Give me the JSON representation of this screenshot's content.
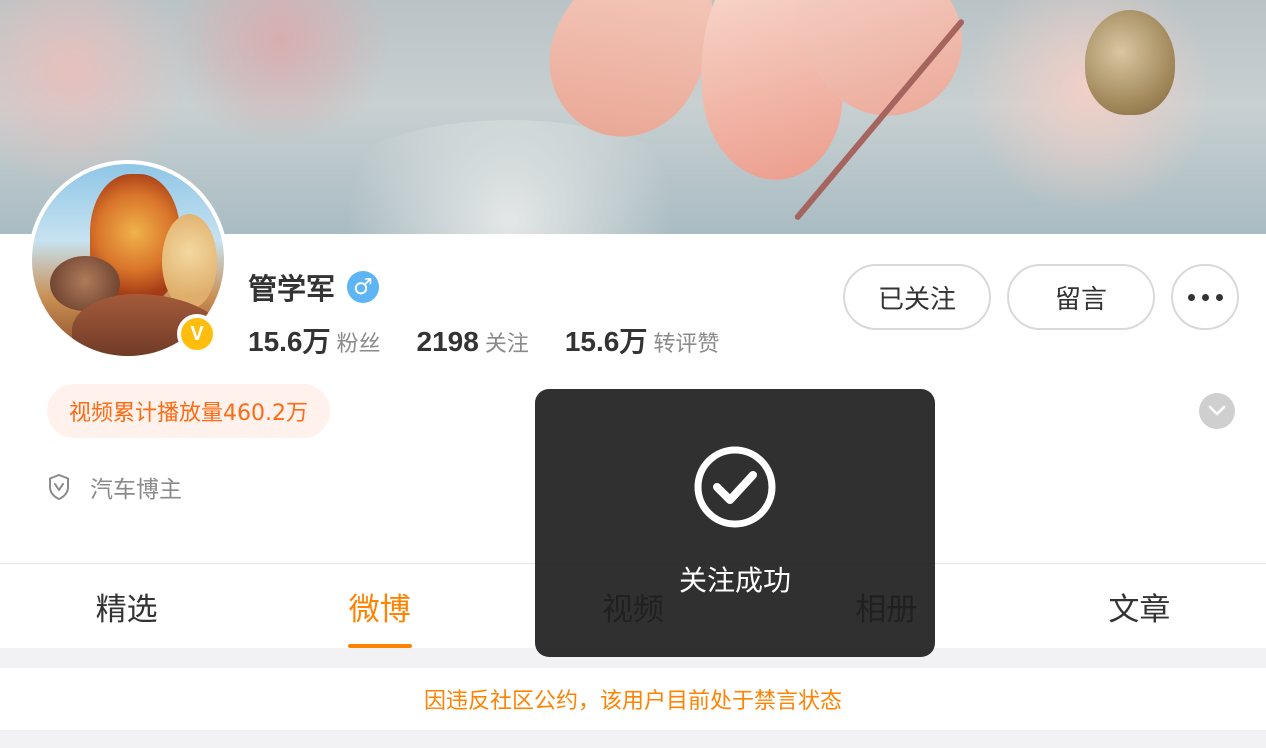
{
  "profile": {
    "username": "管学军",
    "gender_symbol": "♂",
    "verified_badge": "V",
    "stats": [
      {
        "value": "15.6万",
        "label": "粉丝"
      },
      {
        "value": "2198",
        "label": "关注"
      },
      {
        "value": "15.6万",
        "label": "转评赞"
      }
    ],
    "video_play_tag": "视频累计播放量460.2万",
    "verification_text": "汽车博主"
  },
  "actions": {
    "follow_label": "已关注",
    "message_label": "留言"
  },
  "tabs": [
    {
      "label": "精选",
      "active": false
    },
    {
      "label": "微博",
      "active": true
    },
    {
      "label": "视频",
      "active": false
    },
    {
      "label": "相册",
      "active": false
    },
    {
      "label": "文章",
      "active": false
    }
  ],
  "notice": "因违反社区公约，该用户目前处于禁言状态",
  "toast": {
    "message": "关注成功"
  },
  "colors": {
    "accent": "#ff8200",
    "tag_text": "#ff6b14",
    "tag_bg": "#fff1ec",
    "verify_gold": "#ffbe0e",
    "gender_blue": "#5db5f5"
  },
  "icons": {
    "more": "more-dots-icon",
    "expand": "chevron-down-icon",
    "verify": "shield-v-icon",
    "toast": "check-circle-icon"
  }
}
